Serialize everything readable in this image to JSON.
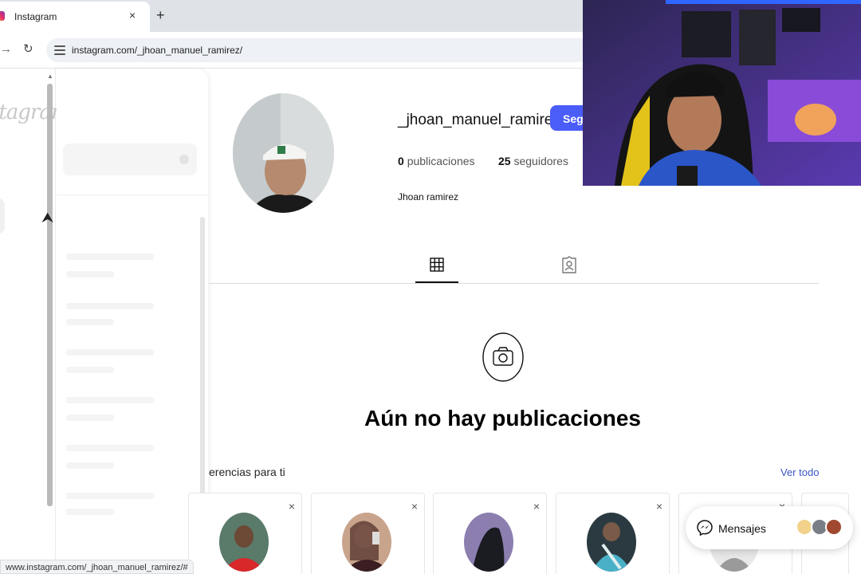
{
  "browser": {
    "tab_title": "Instagram",
    "tab_close": "×",
    "new_tab": "+",
    "url": "instagram.com/_jhoan_manuel_ramirez/",
    "status_url": "www.instagram.com/_jhoan_manuel_ramirez/#"
  },
  "sidebar": {
    "logo_text": "stagram"
  },
  "profile": {
    "username": "_jhoan_manuel_ramirez",
    "follow_label": "Segu",
    "posts_count": "0",
    "posts_label": "publicaciones",
    "followers_count": "25",
    "followers_label": "seguidores",
    "full_name": "Jhoan ramirez"
  },
  "empty_state": {
    "title": "Aún no hay publicaciones"
  },
  "suggestions": {
    "title": "erencias para ti",
    "see_all": "Ver todo",
    "close_glyph": "×"
  },
  "messages": {
    "label": "Mensajes"
  },
  "icons": {
    "grid": "grid-icon",
    "tagged": "tagged-user-icon",
    "camera": "camera-icon",
    "messenger": "messenger-icon"
  },
  "colors": {
    "follow_button": "#4a5df9",
    "link_blue": "#3b56c8",
    "webcam_ambient": "#6a3fd0"
  }
}
